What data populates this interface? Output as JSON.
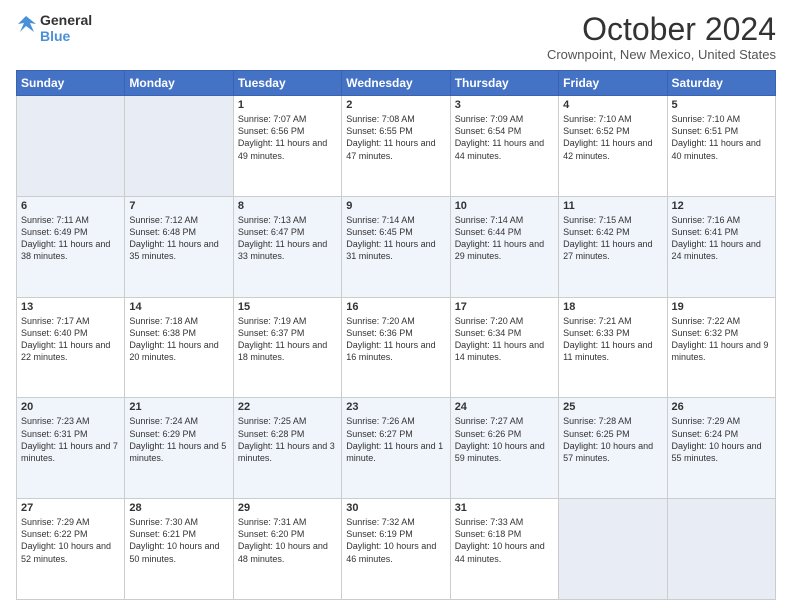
{
  "header": {
    "logo_line1": "General",
    "logo_line2": "Blue",
    "month": "October 2024",
    "location": "Crownpoint, New Mexico, United States"
  },
  "days_of_week": [
    "Sunday",
    "Monday",
    "Tuesday",
    "Wednesday",
    "Thursday",
    "Friday",
    "Saturday"
  ],
  "weeks": [
    [
      {
        "day": "",
        "empty": true
      },
      {
        "day": "",
        "empty": true
      },
      {
        "day": "1",
        "sunrise": "Sunrise: 7:07 AM",
        "sunset": "Sunset: 6:56 PM",
        "daylight": "Daylight: 11 hours and 49 minutes."
      },
      {
        "day": "2",
        "sunrise": "Sunrise: 7:08 AM",
        "sunset": "Sunset: 6:55 PM",
        "daylight": "Daylight: 11 hours and 47 minutes."
      },
      {
        "day": "3",
        "sunrise": "Sunrise: 7:09 AM",
        "sunset": "Sunset: 6:54 PM",
        "daylight": "Daylight: 11 hours and 44 minutes."
      },
      {
        "day": "4",
        "sunrise": "Sunrise: 7:10 AM",
        "sunset": "Sunset: 6:52 PM",
        "daylight": "Daylight: 11 hours and 42 minutes."
      },
      {
        "day": "5",
        "sunrise": "Sunrise: 7:10 AM",
        "sunset": "Sunset: 6:51 PM",
        "daylight": "Daylight: 11 hours and 40 minutes."
      }
    ],
    [
      {
        "day": "6",
        "sunrise": "Sunrise: 7:11 AM",
        "sunset": "Sunset: 6:49 PM",
        "daylight": "Daylight: 11 hours and 38 minutes."
      },
      {
        "day": "7",
        "sunrise": "Sunrise: 7:12 AM",
        "sunset": "Sunset: 6:48 PM",
        "daylight": "Daylight: 11 hours and 35 minutes."
      },
      {
        "day": "8",
        "sunrise": "Sunrise: 7:13 AM",
        "sunset": "Sunset: 6:47 PM",
        "daylight": "Daylight: 11 hours and 33 minutes."
      },
      {
        "day": "9",
        "sunrise": "Sunrise: 7:14 AM",
        "sunset": "Sunset: 6:45 PM",
        "daylight": "Daylight: 11 hours and 31 minutes."
      },
      {
        "day": "10",
        "sunrise": "Sunrise: 7:14 AM",
        "sunset": "Sunset: 6:44 PM",
        "daylight": "Daylight: 11 hours and 29 minutes."
      },
      {
        "day": "11",
        "sunrise": "Sunrise: 7:15 AM",
        "sunset": "Sunset: 6:42 PM",
        "daylight": "Daylight: 11 hours and 27 minutes."
      },
      {
        "day": "12",
        "sunrise": "Sunrise: 7:16 AM",
        "sunset": "Sunset: 6:41 PM",
        "daylight": "Daylight: 11 hours and 24 minutes."
      }
    ],
    [
      {
        "day": "13",
        "sunrise": "Sunrise: 7:17 AM",
        "sunset": "Sunset: 6:40 PM",
        "daylight": "Daylight: 11 hours and 22 minutes."
      },
      {
        "day": "14",
        "sunrise": "Sunrise: 7:18 AM",
        "sunset": "Sunset: 6:38 PM",
        "daylight": "Daylight: 11 hours and 20 minutes."
      },
      {
        "day": "15",
        "sunrise": "Sunrise: 7:19 AM",
        "sunset": "Sunset: 6:37 PM",
        "daylight": "Daylight: 11 hours and 18 minutes."
      },
      {
        "day": "16",
        "sunrise": "Sunrise: 7:20 AM",
        "sunset": "Sunset: 6:36 PM",
        "daylight": "Daylight: 11 hours and 16 minutes."
      },
      {
        "day": "17",
        "sunrise": "Sunrise: 7:20 AM",
        "sunset": "Sunset: 6:34 PM",
        "daylight": "Daylight: 11 hours and 14 minutes."
      },
      {
        "day": "18",
        "sunrise": "Sunrise: 7:21 AM",
        "sunset": "Sunset: 6:33 PM",
        "daylight": "Daylight: 11 hours and 11 minutes."
      },
      {
        "day": "19",
        "sunrise": "Sunrise: 7:22 AM",
        "sunset": "Sunset: 6:32 PM",
        "daylight": "Daylight: 11 hours and 9 minutes."
      }
    ],
    [
      {
        "day": "20",
        "sunrise": "Sunrise: 7:23 AM",
        "sunset": "Sunset: 6:31 PM",
        "daylight": "Daylight: 11 hours and 7 minutes."
      },
      {
        "day": "21",
        "sunrise": "Sunrise: 7:24 AM",
        "sunset": "Sunset: 6:29 PM",
        "daylight": "Daylight: 11 hours and 5 minutes."
      },
      {
        "day": "22",
        "sunrise": "Sunrise: 7:25 AM",
        "sunset": "Sunset: 6:28 PM",
        "daylight": "Daylight: 11 hours and 3 minutes."
      },
      {
        "day": "23",
        "sunrise": "Sunrise: 7:26 AM",
        "sunset": "Sunset: 6:27 PM",
        "daylight": "Daylight: 11 hours and 1 minute."
      },
      {
        "day": "24",
        "sunrise": "Sunrise: 7:27 AM",
        "sunset": "Sunset: 6:26 PM",
        "daylight": "Daylight: 10 hours and 59 minutes."
      },
      {
        "day": "25",
        "sunrise": "Sunrise: 7:28 AM",
        "sunset": "Sunset: 6:25 PM",
        "daylight": "Daylight: 10 hours and 57 minutes."
      },
      {
        "day": "26",
        "sunrise": "Sunrise: 7:29 AM",
        "sunset": "Sunset: 6:24 PM",
        "daylight": "Daylight: 10 hours and 55 minutes."
      }
    ],
    [
      {
        "day": "27",
        "sunrise": "Sunrise: 7:29 AM",
        "sunset": "Sunset: 6:22 PM",
        "daylight": "Daylight: 10 hours and 52 minutes."
      },
      {
        "day": "28",
        "sunrise": "Sunrise: 7:30 AM",
        "sunset": "Sunset: 6:21 PM",
        "daylight": "Daylight: 10 hours and 50 minutes."
      },
      {
        "day": "29",
        "sunrise": "Sunrise: 7:31 AM",
        "sunset": "Sunset: 6:20 PM",
        "daylight": "Daylight: 10 hours and 48 minutes."
      },
      {
        "day": "30",
        "sunrise": "Sunrise: 7:32 AM",
        "sunset": "Sunset: 6:19 PM",
        "daylight": "Daylight: 10 hours and 46 minutes."
      },
      {
        "day": "31",
        "sunrise": "Sunrise: 7:33 AM",
        "sunset": "Sunset: 6:18 PM",
        "daylight": "Daylight: 10 hours and 44 minutes."
      },
      {
        "day": "",
        "empty": true
      },
      {
        "day": "",
        "empty": true
      }
    ]
  ]
}
